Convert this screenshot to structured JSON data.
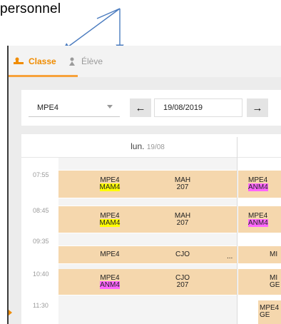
{
  "annotation": {
    "text": "personnel"
  },
  "tabs": {
    "classe": "Classe",
    "eleve": "Élève"
  },
  "toolbar": {
    "class_select": "MPE4",
    "prev_icon": "arrow-left-icon",
    "date": "19/08/2019",
    "next_icon": "arrow-right-icon"
  },
  "calendar": {
    "day_label": "lun.",
    "day_date": "19/08",
    "times": [
      "07:55",
      "08:45",
      "09:35",
      "10:40",
      "11:30"
    ],
    "slots": [
      {
        "class": "MPE4",
        "group": "MAM4",
        "teacher": "MAH",
        "room": "207"
      },
      {
        "class": "MPE4",
        "group": "MAM4",
        "teacher": "MAH",
        "room": "207"
      },
      {
        "class": "MPE4",
        "teacher": "CJO",
        "more": "..."
      },
      {
        "class": "MPE4",
        "group": "ANM4",
        "teacher": "CJO",
        "room": "207"
      }
    ],
    "next_col": [
      {
        "class": "MPE4",
        "group": "ANM4"
      },
      {
        "class": "MPE4",
        "group": "ANM4"
      },
      {
        "class": "MI"
      },
      {
        "class": "MI",
        "extra": "GE"
      },
      {
        "class": "MPE4",
        "extra": "GE"
      }
    ]
  },
  "colors": {
    "accent": "#f08c00",
    "slot": "#f5d7ad",
    "highlight_yellow": "#ffff00",
    "highlight_pink": "#ff66ff"
  }
}
